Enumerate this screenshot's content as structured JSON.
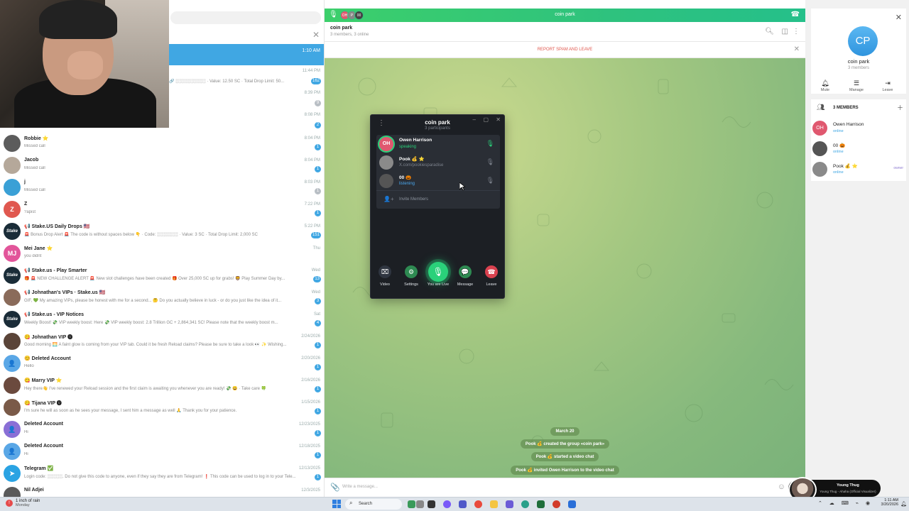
{
  "colors": {
    "accent": "#40a7e3",
    "voice_green": "#2ec27e",
    "danger": "#e0584f",
    "vc_dark": "#1c1f24"
  },
  "left_panel": {
    "active_chat_time": "1:10 AM",
    "orphan_rows": [
      {
        "time": "11:44 PM",
        "preview": "🔗 ░░░░░░░░░░ · Value: 12.50 SC · Total Drop Limit: 50...",
        "badge": "162",
        "muted": false
      },
      {
        "time": "8:39 PM",
        "preview": "",
        "badge": "9",
        "muted": true
      },
      {
        "time": "8:08 PM",
        "preview": "",
        "badge": "2",
        "muted": false
      }
    ],
    "chats": [
      {
        "name": "Robbie ⭐",
        "preview": "Missed call",
        "time": "8:04 PM",
        "badge": "1",
        "muted": false,
        "avatar_text": "",
        "avatar_color": "#5c5c5c",
        "avatar_icon": "person-photo"
      },
      {
        "name": "Jacob",
        "preview": "Missed call",
        "time": "8:04 PM",
        "badge": "1",
        "muted": false,
        "avatar_text": "",
        "avatar_color": "#b5a89a",
        "avatar_icon": "person-photo"
      },
      {
        "name": "j",
        "preview": "Missed call",
        "time": "8:03 PM",
        "badge": "1",
        "muted": true,
        "avatar_text": "",
        "avatar_color": "#3aa0d6",
        "avatar_icon": "person-photo"
      },
      {
        "name": "Z",
        "preview": "?apist",
        "time": "7:22 PM",
        "badge": "1",
        "muted": false,
        "avatar_text": "Z",
        "avatar_color": "#e0584f",
        "avatar_icon": ""
      },
      {
        "name": "📢 Stake.US Daily Drops 🇺🇸",
        "preview": "🚨 Bonus Drop Alert 🚨 The code is without spaces below 👇 · Code: ░░░░░░░ · Value: 3 SC · Total Drop Limit: 2,000 SC",
        "time": "5:22 PM",
        "badge": "151",
        "muted": false,
        "avatar_text": "Stake",
        "avatar_color": "#1a2c38",
        "avatar_icon": ""
      },
      {
        "name": "Mei Jane ⭐",
        "preview": "you didnt",
        "time": "Thu",
        "badge": "",
        "muted": false,
        "avatar_text": "MJ",
        "avatar_color": "#e2559a",
        "avatar_icon": ""
      },
      {
        "name": "📢 Stake.us - Play Smarter",
        "preview": "🎁 🚨 NEW CHALLENGE ALERT 🚨 New slot challenges have been created 🎁 Over 25,000 SC up for grabs! 🦁 Play Summer Day by...",
        "time": "Wed",
        "badge": "13",
        "muted": false,
        "avatar_text": "Stake",
        "avatar_color": "#1a2c38",
        "avatar_icon": ""
      },
      {
        "name": "📢 Johnathan's VIPs · Stake.us 🇺🇸",
        "preview": "GIF, 💚 My amazing VIPs, please be honest with me for a second... 🤔 Do you actually believe in luck - or do you just like the idea of it...",
        "time": "Wed",
        "badge": "3",
        "muted": false,
        "avatar_text": "",
        "avatar_color": "#8a6b5a",
        "avatar_icon": "person-photo"
      },
      {
        "name": "📢 Stake.us - VIP Notices",
        "preview": "Weekly Boost! 💸 VIP weekly boost: Here 💸 VIP weekly boost: 2.8 Trillion GC + 2,864,341 SC! Please note that the weekly boost m...",
        "time": "Sat",
        "badge": "4",
        "muted": false,
        "avatar_text": "Stake",
        "avatar_color": "#1a2c38",
        "avatar_icon": ""
      },
      {
        "name": "😋 Johnathan VIP 🅥",
        "preview": "Good morning 🌅 A faint glow is coming from your VIP tab. Could it be fresh Reload claims? Please be sure to take a look 👀 ✨ Wishing...",
        "time": "2/24/2026",
        "badge": "1",
        "muted": false,
        "avatar_text": "",
        "avatar_color": "#5a4438",
        "avatar_icon": "person-photo"
      },
      {
        "name": "😊 Deleted Account",
        "preview": "Hello",
        "time": "2/20/2026",
        "badge": "1",
        "muted": false,
        "avatar_text": "👤",
        "avatar_color": "#5aa7e6",
        "avatar_icon": "ghost-icon"
      },
      {
        "name": "😋 Marry VIP ⭐",
        "preview": "Hey there👋 I've renewed your Reload session and the first claim is awaiting you whenever you are ready! 💸 😀 · Take care 🍀",
        "time": "2/16/2026",
        "badge": "1",
        "muted": false,
        "avatar_text": "",
        "avatar_color": "#6b4a3e",
        "avatar_icon": "person-photo"
      },
      {
        "name": "😋 Tijana VIP 🅥",
        "preview": "I'm sure he will as soon as he sees your message, I sent him a message as well 🙏 Thank you for your patience.",
        "time": "1/15/2026",
        "badge": "1",
        "muted": false,
        "avatar_text": "",
        "avatar_color": "#7a5a48",
        "avatar_icon": "person-photo"
      },
      {
        "name": "Deleted Account",
        "preview": "Hi",
        "time": "12/23/2025",
        "badge": "1",
        "muted": false,
        "avatar_text": "👤",
        "avatar_color": "#8a6fd6",
        "avatar_icon": "ghost-icon"
      },
      {
        "name": "Deleted Account",
        "preview": "Hi",
        "time": "12/18/2025",
        "badge": "1",
        "muted": false,
        "avatar_text": "👤",
        "avatar_color": "#5aa7e6",
        "avatar_icon": "ghost-icon"
      },
      {
        "name": "Telegram ✅",
        "preview": "Login code: ░░░░░. Do not give this code to anyone, even if they say they are from Telegram! ❗ This code can be used to log in to your Tele...",
        "time": "12/13/2025",
        "badge": "1",
        "muted": false,
        "avatar_text": "➤",
        "avatar_color": "#2aa3e3",
        "avatar_icon": "telegram-icon"
      },
      {
        "name": "Nil Adjei",
        "preview": "",
        "time": "12/3/2025",
        "badge": "",
        "muted": false,
        "avatar_text": "",
        "avatar_color": "#5a5a5a",
        "avatar_icon": "person-photo"
      }
    ]
  },
  "voice_bar": {
    "title": "coin park",
    "participants": [
      "OH",
      "P",
      "00"
    ]
  },
  "chat_header": {
    "title": "coin park",
    "subtitle": "3 members, 3 online"
  },
  "spam_bar": {
    "label": "REPORT SPAM AND LEAVE"
  },
  "service_messages": {
    "date": "March 20",
    "items": [
      "Pook 💰 created the group «coin park»",
      "Pook 💰 started a video chat",
      "Pook 💰 invited Owen Harrison to the video chat"
    ]
  },
  "compose": {
    "placeholder": "Write a message..."
  },
  "voice_chat_window": {
    "title": "coin park",
    "subtitle": "3 participants",
    "participants": [
      {
        "initials": "OH",
        "name": "Owen Harrison",
        "status": "speaking",
        "status_color": "#2ad17a",
        "avatar_color": "#e0586f",
        "mic_color": "#2ad17a"
      },
      {
        "initials": "",
        "name": "Pook 💰 ⭐",
        "status": "X.com/pookiesparadise",
        "status_color": "#7c828c",
        "avatar_color": "#8a8a8a",
        "mic_color": "#7c828c"
      },
      {
        "initials": "",
        "name": "00 🎃",
        "status": "listening",
        "status_color": "#4aa8ef",
        "avatar_color": "#555",
        "mic_color": "#7c828c"
      }
    ],
    "invite_label": "Invite Members",
    "buttons": {
      "video": "Video",
      "settings": "Settings",
      "live": "You are Live",
      "message": "Message",
      "leave": "Leave"
    }
  },
  "right_panel": {
    "avatar_initials": "CP",
    "group_name": "coin park",
    "group_sub": "3 members",
    "actions": {
      "mute": "Mute",
      "manage": "Manage",
      "leave": "Leave"
    },
    "members_header": "3 MEMBERS",
    "members": [
      {
        "initials": "OH",
        "name": "Owen Harrison",
        "status": "online",
        "tag": "",
        "avatar_color": "#e0586f"
      },
      {
        "initials": "",
        "name": "00 🎃",
        "status": "online",
        "tag": "",
        "avatar_color": "#555"
      },
      {
        "initials": "",
        "name": "Pook 💰 ⭐",
        "status": "online",
        "tag": "owner",
        "avatar_color": "#8a8a8a"
      }
    ]
  },
  "now_playing": {
    "title": "Young Thug",
    "subtitle": "Young Thug - Ahaha (Official Visualizer)"
  },
  "taskbar": {
    "weather_main": "1 inch of rain",
    "weather_sub": "Monday",
    "search_label": "Search",
    "time": "1:11 AM",
    "date": "3/20/2026"
  }
}
